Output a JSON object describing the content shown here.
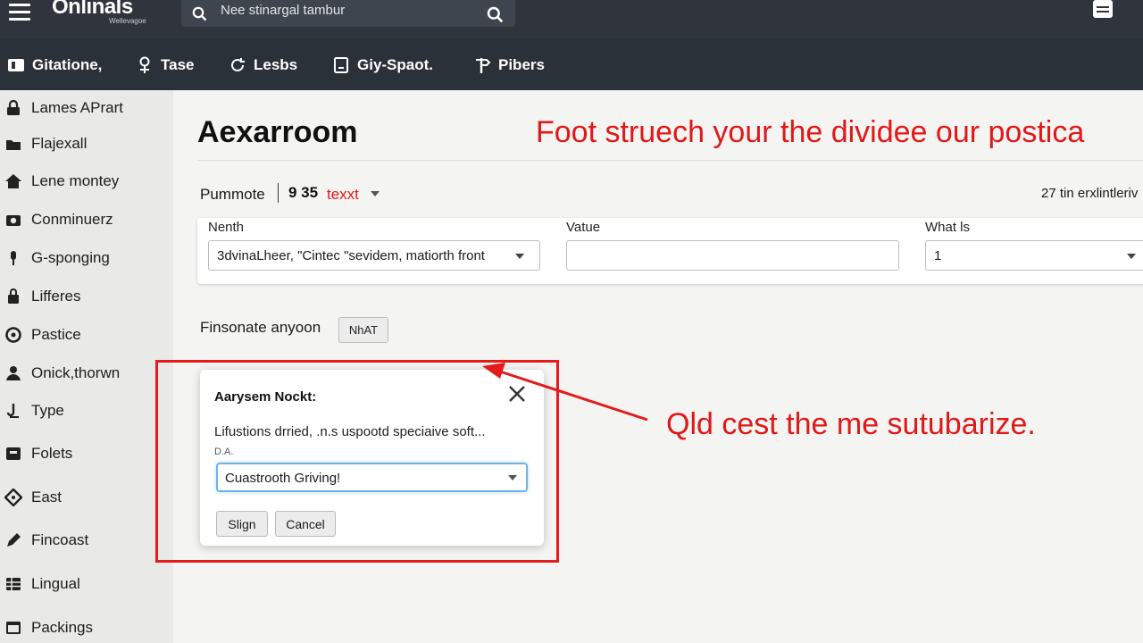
{
  "header": {
    "logo": "Onlinals",
    "logo_sub": "Wellevagoe",
    "search_placeholder": "Nee stinargal tambur"
  },
  "nav": {
    "items": [
      {
        "label": "Gitatione,",
        "icon": "book-icon"
      },
      {
        "label": "Tase",
        "icon": "person-icon"
      },
      {
        "label": "Lesbs",
        "icon": "refresh-icon"
      },
      {
        "label": "Giy-Spaot.",
        "icon": "document-icon"
      },
      {
        "label": "Pibers",
        "icon": "signpost-icon"
      }
    ]
  },
  "sidebar": {
    "items": [
      {
        "label": "Lames APrart",
        "icon": "lock-icon"
      },
      {
        "label": "Flajexall",
        "icon": "folder-icon"
      },
      {
        "label": "Lene montey",
        "icon": "home-icon"
      },
      {
        "label": "Conminuerz",
        "icon": "camera-icon"
      },
      {
        "label": "G-sponging",
        "icon": "microphone-icon"
      },
      {
        "label": "Lifferes",
        "icon": "lock-icon"
      },
      {
        "label": "Pastice",
        "icon": "circle-icon"
      },
      {
        "label": "Onick,thorwn",
        "icon": "user-icon"
      },
      {
        "label": "Type",
        "icon": "hook-icon"
      },
      {
        "label": "Folets",
        "icon": "archive-icon"
      },
      {
        "label": "East",
        "icon": "tag-icon"
      },
      {
        "label": "Fincoast",
        "icon": "pen-icon"
      },
      {
        "label": "Lingual",
        "icon": "grid-icon"
      },
      {
        "label": "Packings",
        "icon": "window-icon"
      }
    ]
  },
  "main": {
    "title": "Aexarroom",
    "promo": "Foot struech your the dividee our postica",
    "filter": {
      "label": "Pummote",
      "number": "9 35",
      "red_text": "texxt"
    },
    "right_count": "27 tin erxlintleriv",
    "form": {
      "field1_label": "Nenth",
      "field1_value": "3dvinaLheer, \"Cintec \"sevidem, matiorth front",
      "field2_label": "Vatue",
      "field2_value": "",
      "field3_label": "What ls",
      "field3_value": "1"
    },
    "person_label": "Finsonate anyoon",
    "person_button": "NhAT"
  },
  "dialog": {
    "title": "Aarysem Nockt:",
    "text": "Lifustions drried, .n.s uspootd speciaive soft...",
    "small": "D.A.",
    "select_value": "Cuastrooth Griving!",
    "sign_button": "Slign",
    "cancel_button": "Cancel"
  },
  "annotation": {
    "text": "Qld cest the me sutubarize.",
    "color": "#e01818"
  },
  "colors": {
    "topbar": "#30353d",
    "navbar": "#2b3139",
    "sidebar": "#e9e9e8",
    "accent_red": "#e01818",
    "focus_blue": "#6fb3e6"
  }
}
